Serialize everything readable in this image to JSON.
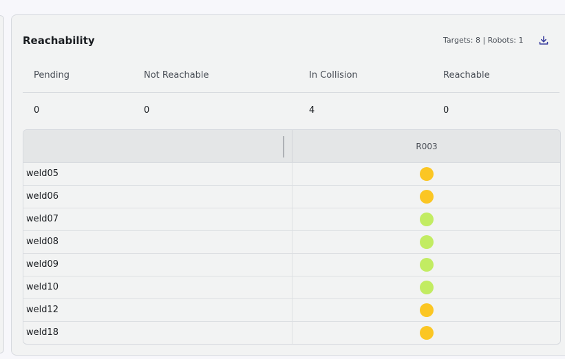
{
  "card": {
    "title": "Reachability",
    "meta": "Targets: 8 | Robots: 1",
    "download_icon": "download-icon"
  },
  "summary": {
    "headers": [
      "Pending",
      "Not Reachable",
      "In Collision",
      "Reachable"
    ],
    "values": [
      "0",
      "0",
      "4",
      "0"
    ]
  },
  "grid": {
    "header_first": "",
    "robot_column": "R003",
    "rows": [
      {
        "name": "weld05",
        "status": "collision"
      },
      {
        "name": "weld06",
        "status": "collision"
      },
      {
        "name": "weld07",
        "status": "reachable"
      },
      {
        "name": "weld08",
        "status": "reachable"
      },
      {
        "name": "weld09",
        "status": "reachable"
      },
      {
        "name": "weld10",
        "status": "reachable"
      },
      {
        "name": "weld12",
        "status": "collision"
      },
      {
        "name": "weld18",
        "status": "collision"
      }
    ]
  },
  "colors": {
    "collision": "#fbc623",
    "reachable": "#c2ec62",
    "accent": "#3b3f9e"
  }
}
